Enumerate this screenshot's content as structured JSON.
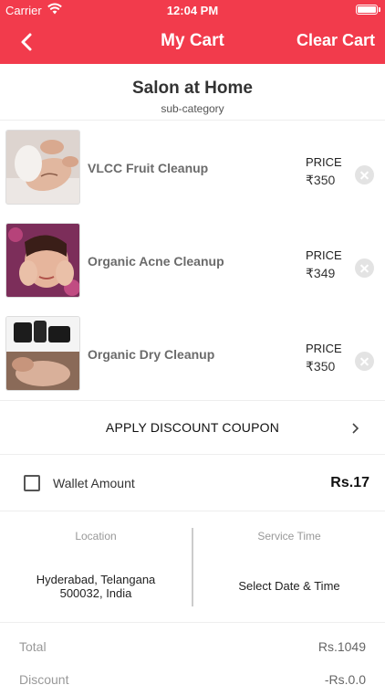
{
  "status_bar": {
    "carrier": "Carrier",
    "time": "12:04 PM"
  },
  "nav": {
    "title": "My Cart",
    "clear_label": "Clear Cart"
  },
  "category": {
    "name": "Salon at Home",
    "subcategory": "sub-category"
  },
  "items": [
    {
      "name": "VLCC Fruit Cleanup",
      "price_label": "PRICE",
      "price": "₹350"
    },
    {
      "name": "Organic Acne Cleanup",
      "price_label": "PRICE",
      "price": "₹349"
    },
    {
      "name": "Organic Dry Cleanup",
      "price_label": "PRICE",
      "price": "₹350"
    }
  ],
  "coupon": {
    "label": "APPLY DISCOUNT COUPON"
  },
  "wallet": {
    "label": "Wallet Amount",
    "amount": "Rs.17",
    "checked": false
  },
  "location": {
    "title": "Location",
    "value_line1": "Hyderabad, Telangana",
    "value_line2": "500032, India"
  },
  "service_time": {
    "title": "Service Time",
    "value": "Select Date & Time"
  },
  "totals": {
    "total_label": "Total",
    "total_value": "Rs.1049",
    "discount_label": "Discount",
    "discount_value": "-Rs.0.0"
  },
  "colors": {
    "accent": "#f23b4c",
    "muted_text": "#999999",
    "item_text": "#6b6b6b"
  }
}
